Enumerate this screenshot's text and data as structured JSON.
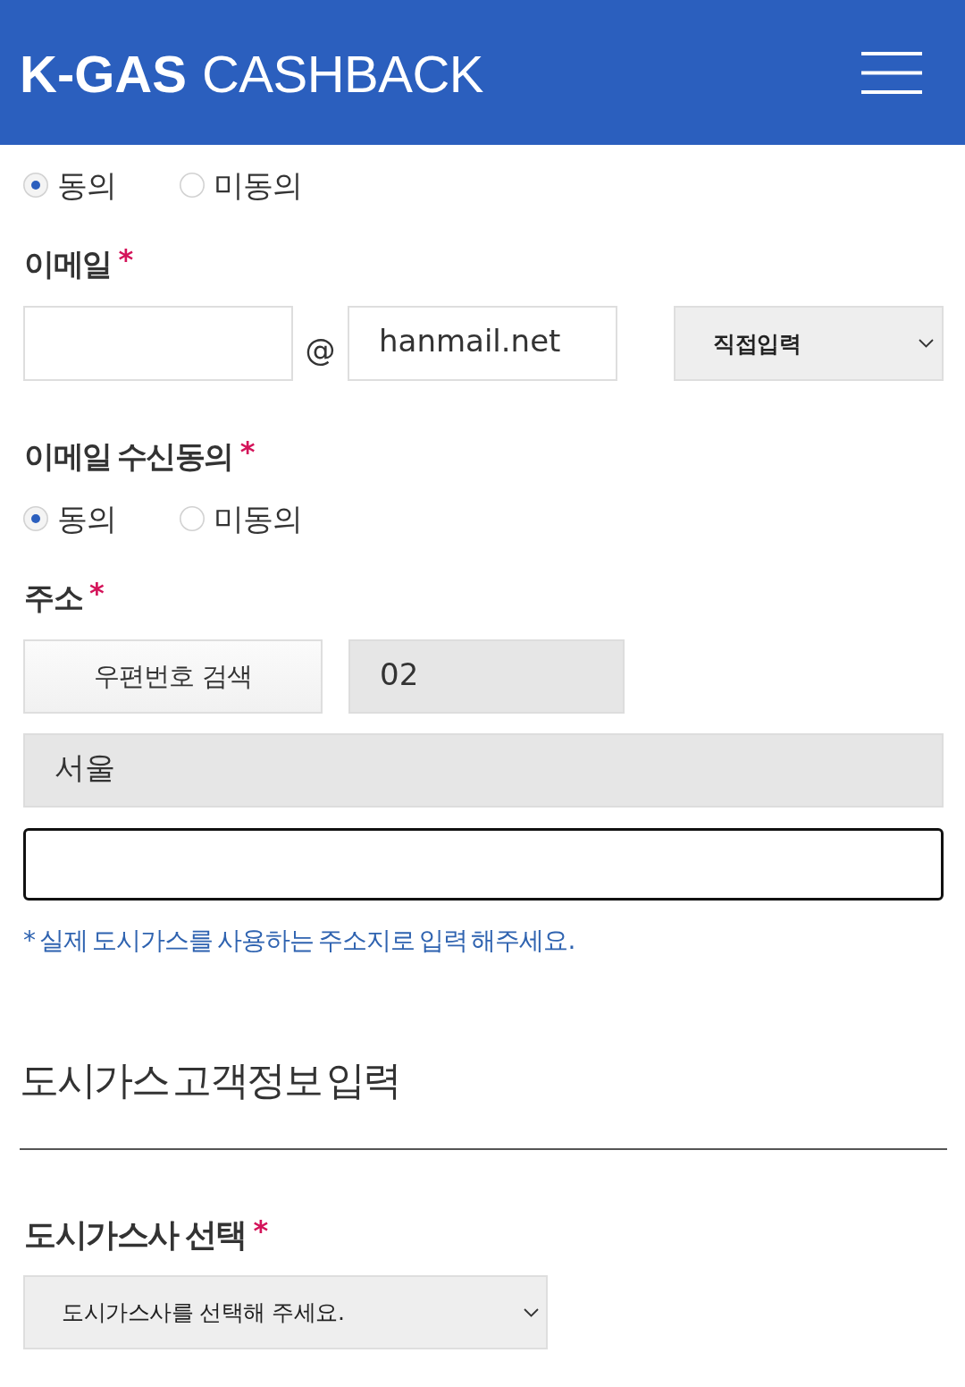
{
  "header": {
    "logo_bold": "K-GAS",
    "logo_light": "CASHBACK"
  },
  "prev_consent": {
    "options": [
      {
        "label": "동의",
        "selected": true
      },
      {
        "label": "미동의",
        "selected": false
      }
    ]
  },
  "email": {
    "label": "이메일",
    "required_mark": "*",
    "at_sign": "@",
    "domain_field": {
      "value": "hanmail.net"
    },
    "domain_select": "직접입력"
  },
  "email_consent": {
    "label": "이메일 수신동의",
    "required_mark": "*",
    "options": [
      {
        "label": "동의",
        "selected": true
      },
      {
        "label": "미동의",
        "selected": false
      }
    ]
  },
  "address": {
    "label": "주소",
    "required_mark": "*",
    "zip_button": "우편번호 검색",
    "zip_field": {
      "value": "02",
      "readonly": true
    },
    "road_field": {
      "value": "서울",
      "readonly": true
    },
    "detail_field": {
      "focused": true
    },
    "note": "* 실제 도시가스를 사용하는 주소지로 입력 해주세요."
  },
  "gas_section": {
    "title": "도시가스 고객정보 입력",
    "company": {
      "label": "도시가스사 선택",
      "required_mark": "*",
      "select": "도시가스사를 선택해 주세요."
    }
  }
}
